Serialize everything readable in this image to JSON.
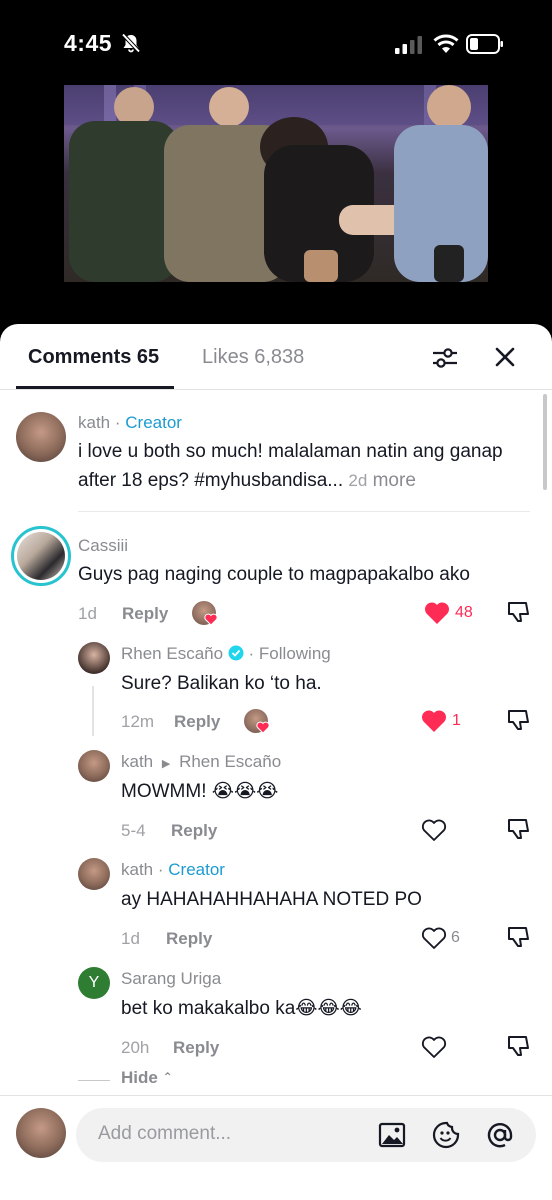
{
  "status": {
    "time": "4:45"
  },
  "tabs": {
    "comments": "Comments 65",
    "likes": "Likes 6,838"
  },
  "comments": [
    {
      "name": "kath",
      "badge": "Creator",
      "text": "i love u both so much! malalaman natin ang ganap after 18 eps? #myhusbandisa...",
      "time": "2d",
      "more": "more"
    },
    {
      "name": "Cassiii",
      "text": "Guys pag naging couple to magpapakalbo ako",
      "time": "1d",
      "reply": "Reply",
      "likes": "48"
    },
    {
      "name": "Rhen Escaño",
      "following": "Following",
      "text": "Sure? Balikan ko ‘to ha.",
      "time": "12m",
      "reply": "Reply",
      "likes": "1"
    },
    {
      "name": "kath",
      "reply_to": "Rhen Escaño",
      "text": "MOWMM! 😭😭😭",
      "time": "5-4",
      "reply": "Reply"
    },
    {
      "name": "kath",
      "badge": "Creator",
      "text": "ay HAHAHAHHAHAHA NOTED PO",
      "time": "1d",
      "reply": "Reply",
      "likes": "6"
    },
    {
      "name": "Sarang Uriga",
      "avatar_letter": "Y",
      "text": "bet ko makakalbo ka😂😂😂",
      "time": "20h",
      "reply": "Reply"
    }
  ],
  "hide": "Hide",
  "composer": {
    "placeholder": "Add comment..."
  },
  "colors": {
    "accent": "#fe2c55",
    "creator": "#1d9bd1",
    "text": "#161823"
  }
}
